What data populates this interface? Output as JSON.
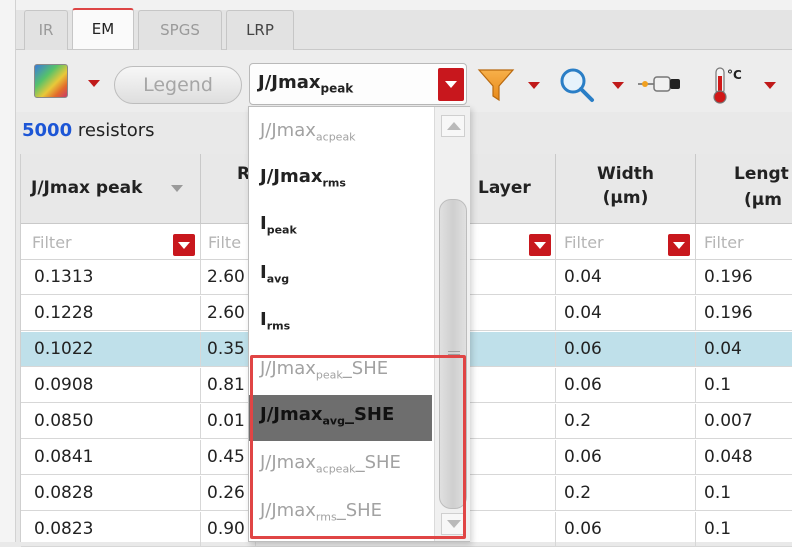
{
  "tabs": [
    {
      "label": "IR",
      "active": false
    },
    {
      "label": "EM",
      "active": true
    },
    {
      "label": "SPGS",
      "active": false
    },
    {
      "label": "LRP",
      "active": false
    }
  ],
  "toolbar": {
    "legend_label": "Legend",
    "metric_selected_main": "J/Jmax",
    "metric_selected_sub": "peak",
    "icons": [
      "heatmap-icon",
      "filter-icon",
      "zoom-icon",
      "probe-icon",
      "thermometer-icon"
    ],
    "thermometer_label": "°C"
  },
  "status": {
    "count": "5000",
    "count_suffix": " resistors"
  },
  "table": {
    "headers": {
      "jjmax": "J/Jmax peak",
      "r": "R",
      "layer": "Layer",
      "width": "Width",
      "width_unit": "(µm)",
      "length": "Lengt",
      "length_unit": "(µm"
    },
    "filter_placeholder": "Filter",
    "filter_partial": "Filte",
    "rows": [
      {
        "jjmax": "0.1313",
        "r": "2.60",
        "width": "0.04",
        "length": "0.196",
        "selected": false
      },
      {
        "jjmax": "0.1228",
        "r": "2.60",
        "width": "0.04",
        "length": "0.196",
        "selected": false
      },
      {
        "jjmax": "0.1022",
        "r": "0.35",
        "width": "0.06",
        "length": "0.04",
        "selected": true
      },
      {
        "jjmax": "0.0908",
        "r": "0.81",
        "width": "0.06",
        "length": "0.1",
        "selected": false
      },
      {
        "jjmax": "0.0850",
        "r": "0.01",
        "width": "0.2",
        "length": "0.007",
        "selected": false
      },
      {
        "jjmax": "0.0841",
        "r": "0.45",
        "width": "0.06",
        "length": "0.048",
        "selected": false
      },
      {
        "jjmax": "0.0828",
        "r": "0.26",
        "width": "0.2",
        "length": "0.1",
        "selected": false
      },
      {
        "jjmax": "0.0823",
        "r": "0.90",
        "width": "0.06",
        "length": "0.1",
        "selected": false
      }
    ]
  },
  "dropdown": {
    "options": [
      {
        "main": "J/Jmax",
        "sub": "acpeak",
        "suffix": "",
        "style": "dim"
      },
      {
        "main": "J/Jmax",
        "sub": "rms",
        "suffix": "",
        "style": "bold"
      },
      {
        "main": "I",
        "sub": "peak",
        "suffix": "",
        "style": "bold"
      },
      {
        "main": "I",
        "sub": "avg",
        "suffix": "",
        "style": "bold"
      },
      {
        "main": "I",
        "sub": "rms",
        "suffix": "",
        "style": "bold"
      },
      {
        "main": "J/Jmax",
        "sub": "peak",
        "suffix": "_SHE",
        "style": "dim"
      },
      {
        "main": "J/Jmax",
        "sub": "avg",
        "suffix": "_SHE",
        "style": "highlighted"
      },
      {
        "main": "J/Jmax",
        "sub": "acpeak",
        "suffix": "_SHE",
        "style": "dim"
      },
      {
        "main": "J/Jmax",
        "sub": "rms",
        "suffix": "_SHE",
        "style": "dim"
      }
    ]
  },
  "colors": {
    "accent_red": "#c8171d",
    "selected_row": "#bfe0ea",
    "count_blue": "#1d56d6",
    "annotation_box": "#e04545"
  }
}
